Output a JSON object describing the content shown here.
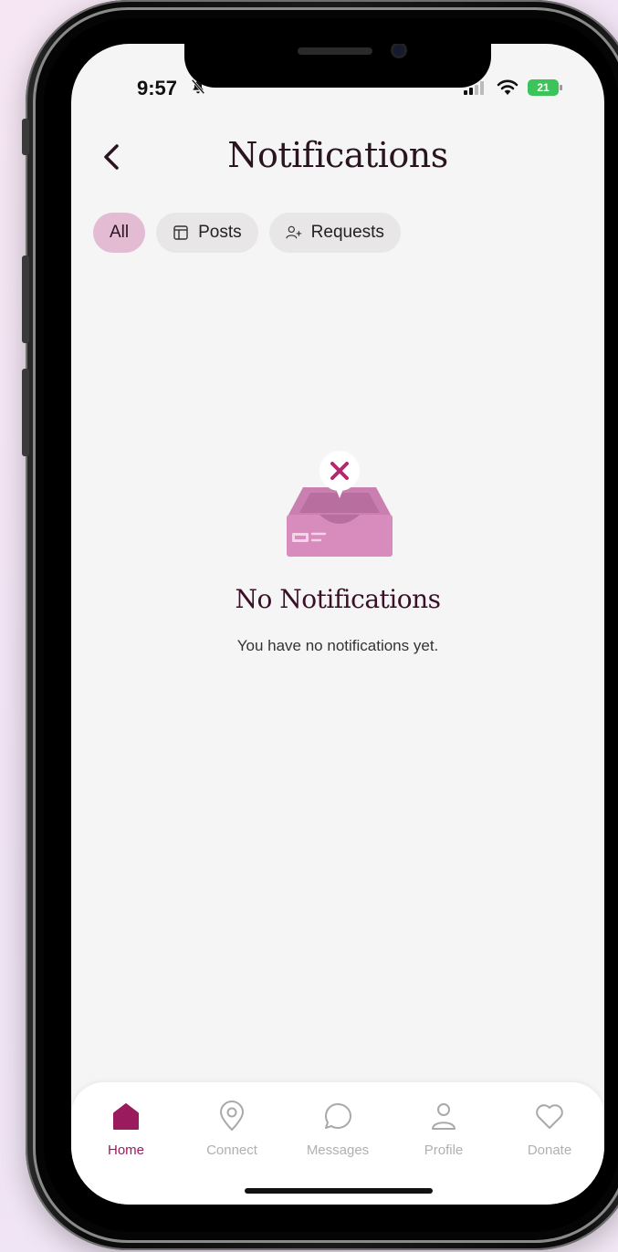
{
  "status": {
    "time": "9:57",
    "battery": "21"
  },
  "header": {
    "title": "Notifications"
  },
  "filters": [
    {
      "label": "All",
      "active": true
    },
    {
      "label": "Posts",
      "icon": "posts-icon"
    },
    {
      "label": "Requests",
      "icon": "add-person-icon"
    }
  ],
  "empty_state": {
    "title": "No Notifications",
    "subtitle": "You have no notifications yet."
  },
  "nav": [
    {
      "label": "Home",
      "icon": "home-icon",
      "active": true
    },
    {
      "label": "Connect",
      "icon": "location-pin-icon"
    },
    {
      "label": "Messages",
      "icon": "chat-bubble-icon"
    },
    {
      "label": "Profile",
      "icon": "person-icon"
    },
    {
      "label": "Donate",
      "icon": "heart-icon"
    }
  ],
  "colors": {
    "accent": "#9b1b5f",
    "chip_active": "#e3bcd4",
    "illustration": "#d88cbd",
    "title": "#2a1420"
  }
}
